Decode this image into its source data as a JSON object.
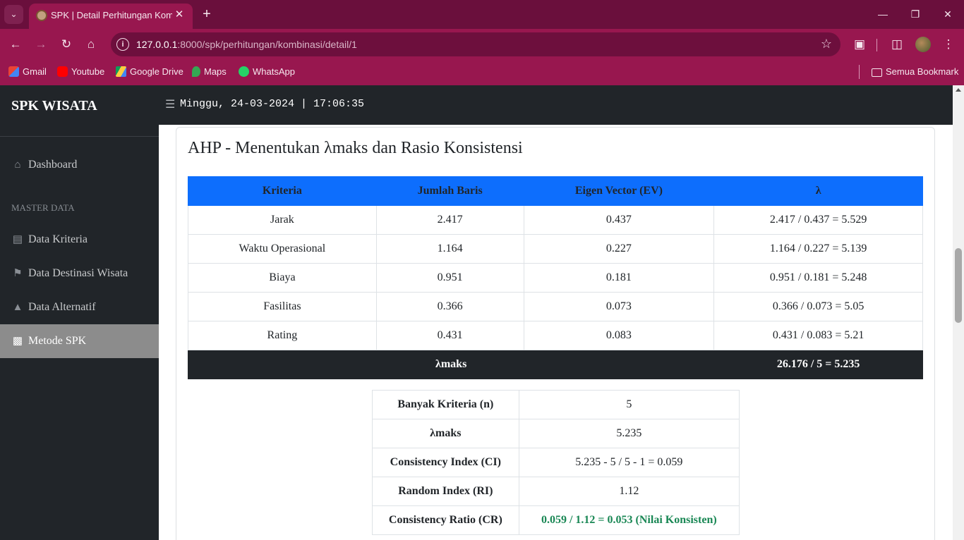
{
  "browser": {
    "tab_title": "SPK | Detail Perhitungan Kombinasi",
    "url_host": "127.0.0.1",
    "url_path": ":8000/spk/perhitungan/kombinasi/detail/1",
    "bookmarks": [
      "Gmail",
      "Youtube",
      "Google Drive",
      "Maps",
      "WhatsApp"
    ],
    "all_bookmarks_label": "Semua Bookmark"
  },
  "sidebar": {
    "brand": "SPK WISATA",
    "dashboard": "Dashboard",
    "section_heading": "MASTER DATA",
    "items": [
      "Data Kriteria",
      "Data Destinasi Wisata",
      "Data Alternatif",
      "Metode SPK"
    ],
    "active_item": "Metode SPK"
  },
  "topbar": {
    "datetime": "Minggu, 24-03-2024 | 17:06:35"
  },
  "card": {
    "title": "AHP - Menentukan λmaks dan Rasio Konsistensi"
  },
  "lambda_table": {
    "headers": [
      "Kriteria",
      "Jumlah Baris",
      "Eigen Vector (EV)",
      "λ"
    ],
    "rows": [
      [
        "Jarak",
        "2.417",
        "0.437",
        "2.417 / 0.437 = 5.529"
      ],
      [
        "Waktu Operasional",
        "1.164",
        "0.227",
        "1.164 / 0.227 = 5.139"
      ],
      [
        "Biaya",
        "0.951",
        "0.181",
        "0.951 / 0.181 = 5.248"
      ],
      [
        "Fasilitas",
        "0.366",
        "0.073",
        "0.366 / 0.073 = 5.05"
      ],
      [
        "Rating",
        "0.431",
        "0.083",
        "0.431 / 0.083 = 5.21"
      ]
    ],
    "footer_label": "λmaks",
    "footer_value": "26.176 / 5 = 5.235"
  },
  "consistency_table": {
    "rows": [
      [
        "Banyak Kriteria (n)",
        "5"
      ],
      [
        "λmaks",
        "5.235"
      ],
      [
        "Consistency Index (CI)",
        "5.235 - 5 / 5 - 1 = 0.059"
      ],
      [
        "Random Index (RI)",
        "1.12"
      ],
      [
        "Consistency Ratio (CR)",
        "0.059 / 1.12 = 0.053 (Nilai Konsisten)"
      ]
    ],
    "consistent_color": "#198754"
  },
  "colors": {
    "browser_frame": "#98174f",
    "sidebar_bg": "#212529",
    "table_header": "#0d6efd",
    "active_item_bg": "#8c8c8c"
  }
}
